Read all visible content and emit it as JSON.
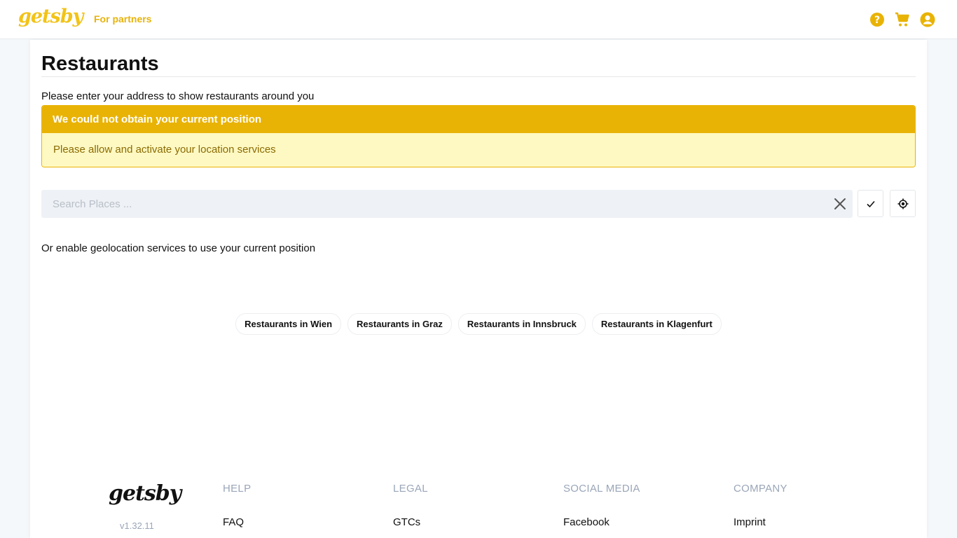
{
  "header": {
    "logo": "getsby",
    "partners_link": "For partners",
    "icons": [
      "help-icon",
      "cart-icon",
      "account-icon"
    ],
    "accent_color": "#e9b306"
  },
  "main": {
    "title": "Restaurants",
    "intro": "Please enter your address to show restaurants around you",
    "alert": {
      "title": "We could not obtain your current position",
      "message": "Please allow and activate your location services"
    },
    "search": {
      "placeholder": "Search Places ...",
      "value": ""
    },
    "geo_text": "Or enable geolocation services to use your current position",
    "cities": [
      "Restaurants in Wien",
      "Restaurants in Graz",
      "Restaurants in Innsbruck",
      "Restaurants in Klagenfurt"
    ]
  },
  "footer": {
    "logo": "getsby",
    "version": "v1.32.11",
    "columns": [
      {
        "heading": "HELP",
        "link": "FAQ"
      },
      {
        "heading": "LEGAL",
        "link": "GTCs"
      },
      {
        "heading": "SOCIAL MEDIA",
        "link": "Facebook"
      },
      {
        "heading": "COMPANY",
        "link": "Imprint"
      }
    ]
  }
}
